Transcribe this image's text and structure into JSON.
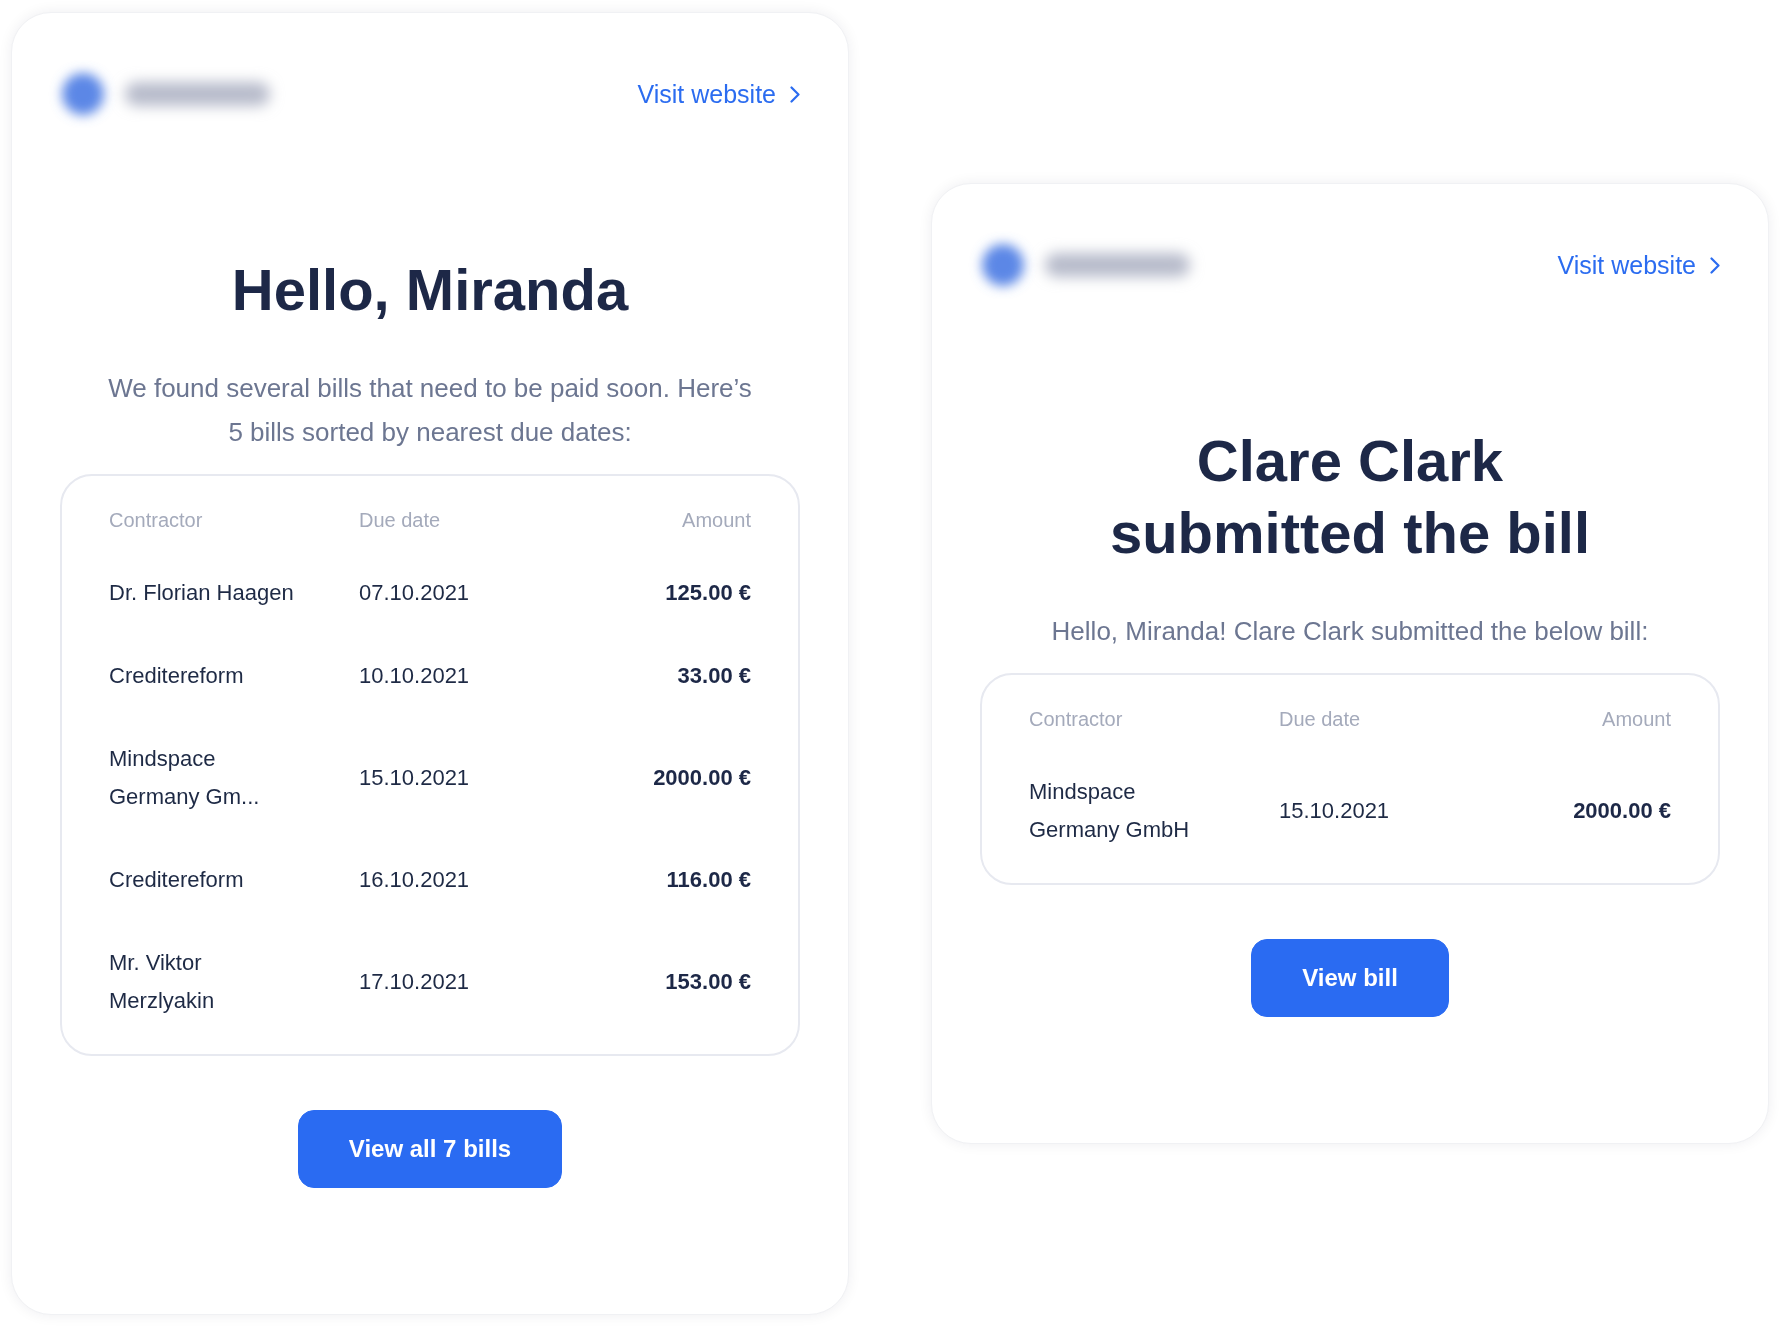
{
  "cards": [
    {
      "link": "Visit website",
      "title": "Hello, Miranda",
      "message": "We found several bills that need to be paid soon. Here’s 5 bills sorted by nearest due dates:",
      "table": {
        "columns": [
          "Contractor",
          "Due date",
          "Amount"
        ],
        "rows": [
          {
            "contractor": "Dr. Florian Haagen",
            "due_date": "07.10.2021",
            "amount": "125.00 €"
          },
          {
            "contractor": "Creditereform",
            "due_date": "10.10.2021",
            "amount": "33.00 €"
          },
          {
            "contractor": "Mindspace Germany Gm...",
            "due_date": "15.10.2021",
            "amount": "2000.00 €"
          },
          {
            "contractor": "Creditereform",
            "due_date": "16.10.2021",
            "amount": "116.00 €"
          },
          {
            "contractor": "Mr. Viktor Merzlyakin",
            "due_date": "17.10.2021",
            "amount": "153.00 €"
          }
        ]
      },
      "button": "View all 7 bills"
    },
    {
      "link": "Visit website",
      "title": "Clare Clark submitted the bill",
      "message": "Hello, Miranda! Clare Clark submitted the below bill:",
      "table": {
        "columns": [
          "Contractor",
          "Due date",
          "Amount"
        ],
        "rows": [
          {
            "contractor": "Mindspace Germany GmbH",
            "due_date": "15.10.2021",
            "amount": "2000.00 €"
          }
        ]
      },
      "button": "View bill"
    }
  ]
}
